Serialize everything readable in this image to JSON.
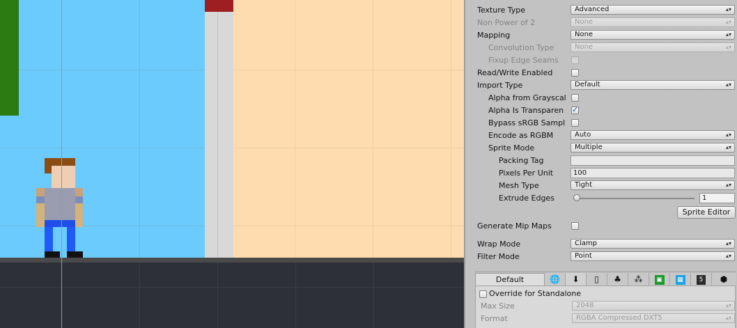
{
  "inspector": {
    "rows": [
      {
        "key": "texture_type",
        "label": "Texture Type",
        "value": "Advanced"
      },
      {
        "key": "non_power_of_2",
        "label": "Non Power of 2",
        "value": "None"
      },
      {
        "key": "mapping",
        "label": "Mapping",
        "value": "None"
      },
      {
        "key": "convolution_type",
        "label": "Convolution Type",
        "value": "None"
      },
      {
        "key": "fixup_edge_seams",
        "label": "Fixup Edge Seams"
      },
      {
        "key": "read_write_enabled",
        "label": "Read/Write Enabled"
      },
      {
        "key": "import_type",
        "label": "Import Type",
        "value": "Default"
      },
      {
        "key": "alpha_from_grayscale",
        "label": "Alpha from Grayscal"
      },
      {
        "key": "alpha_is_transparency",
        "label": "Alpha Is Transparen",
        "checked": true
      },
      {
        "key": "bypass_srgb",
        "label": "Bypass sRGB Sampl"
      },
      {
        "key": "encode_as_rgbm",
        "label": "Encode as RGBM",
        "value": "Auto"
      },
      {
        "key": "sprite_mode",
        "label": "Sprite Mode",
        "value": "Multiple"
      },
      {
        "key": "packing_tag",
        "label": "Packing Tag",
        "value": ""
      },
      {
        "key": "pixels_per_unit",
        "label": "Pixels Per Unit",
        "value": "100"
      },
      {
        "key": "mesh_type",
        "label": "Mesh Type",
        "value": "Tight"
      },
      {
        "key": "extrude_edges",
        "label": "Extrude Edges",
        "value": "1",
        "slider_fraction": 0
      }
    ],
    "sprite_editor_label": "Sprite Editor",
    "generate_mip_maps_label": "Generate Mip Maps",
    "wrap_mode": {
      "label": "Wrap Mode",
      "value": "Clamp"
    },
    "filter_mode": {
      "label": "Filter Mode",
      "value": "Point"
    },
    "platform_tabs": {
      "default_label": "Default",
      "icons": [
        "globe-icon",
        "download-icon",
        "phone-icon",
        "android-icon",
        "blackberry-icon",
        "windows-store-icon",
        "windows-phone-icon",
        "html5-icon",
        "cube-icon"
      ]
    },
    "platform_panel": {
      "override_label": "Override for Standalone",
      "max_size_label": "Max Size",
      "max_size_value": "2048",
      "format_label": "Format",
      "format_value": "RGBA Compressed DXT5"
    }
  },
  "colors": {
    "sky": "#6ccbfd",
    "accent_check": "#1e4a8c",
    "peach": "#ffdcaf",
    "wall_cap": "#9e1f22"
  }
}
